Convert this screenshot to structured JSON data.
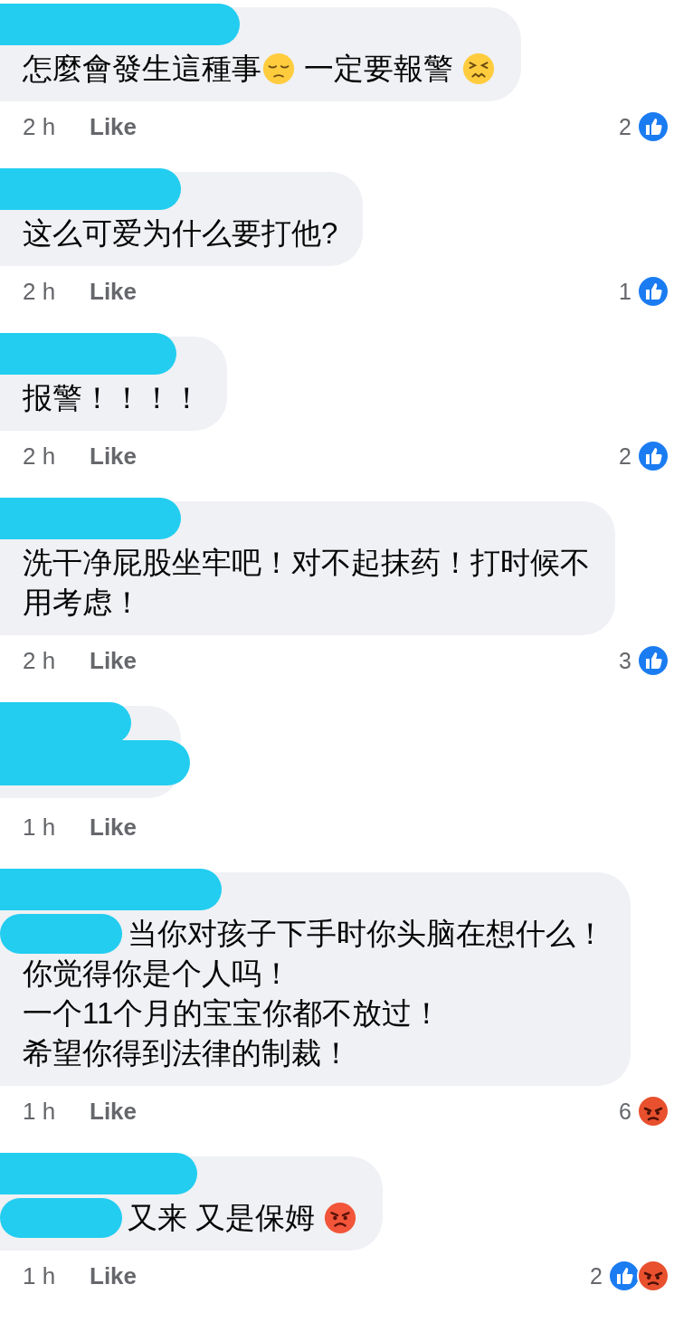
{
  "comments": [
    {
      "name_redacted": true,
      "lines": [
        [
          {
            "kind": "text",
            "text": "怎麼會發生這種事"
          },
          {
            "kind": "pensive-emoji"
          },
          {
            "kind": "text",
            "text": " 一定要報警 "
          },
          {
            "kind": "persevering-emoji"
          }
        ]
      ],
      "time": "2 h",
      "like": "Like",
      "reaction_count": "2",
      "reactions": [
        {
          "kind": "like"
        }
      ]
    },
    {
      "name_redacted": true,
      "lines": [
        [
          {
            "kind": "text",
            "text": "这么可爱为什么要打他?"
          }
        ]
      ],
      "time": "2 h",
      "like": "Like",
      "reaction_count": "1",
      "reactions": [
        {
          "kind": "like"
        }
      ]
    },
    {
      "name_redacted": true,
      "lines": [
        [
          {
            "kind": "text",
            "text": "报警！！！！"
          }
        ]
      ],
      "time": "2 h",
      "like": "Like",
      "reaction_count": "2",
      "reactions": [
        {
          "kind": "like"
        }
      ]
    },
    {
      "name_redacted": true,
      "lines": [
        [
          {
            "kind": "text",
            "text": "洗干净屁股坐牢吧！对不起抹药！打时候不"
          }
        ],
        [
          {
            "kind": "text",
            "text": "用考虑！"
          }
        ]
      ],
      "time": "2 h",
      "like": "Like",
      "reaction_count": "3",
      "reactions": [
        {
          "kind": "like"
        }
      ]
    },
    {
      "name_redacted": true,
      "time": "1 h",
      "like": "Like"
    },
    {
      "name_redacted": true,
      "lines": [
        [
          {
            "kind": "redacted"
          },
          {
            "kind": "text",
            "text": "当你对孩子下手时你头脑在想什么！"
          }
        ],
        [
          {
            "kind": "text",
            "text": "你觉得你是个人吗！"
          }
        ],
        [
          {
            "kind": "text",
            "text": "一个11个月的宝宝你都不放过！"
          }
        ],
        [
          {
            "kind": "text",
            "text": "希望你得到法律的制裁！"
          }
        ]
      ],
      "time": "1 h",
      "like": "Like",
      "reaction_count": "6",
      "reactions": [
        {
          "kind": "angry"
        }
      ]
    },
    {
      "name_redacted": true,
      "lines": [
        [
          {
            "kind": "redacted"
          },
          {
            "kind": "text",
            "text": "又来 又是保姆 "
          },
          {
            "kind": "angry-emoji"
          }
        ]
      ],
      "time": "1 h",
      "like": "Like",
      "reaction_count": "2",
      "reactions": [
        {
          "kind": "like"
        },
        {
          "kind": "angry"
        }
      ]
    }
  ]
}
